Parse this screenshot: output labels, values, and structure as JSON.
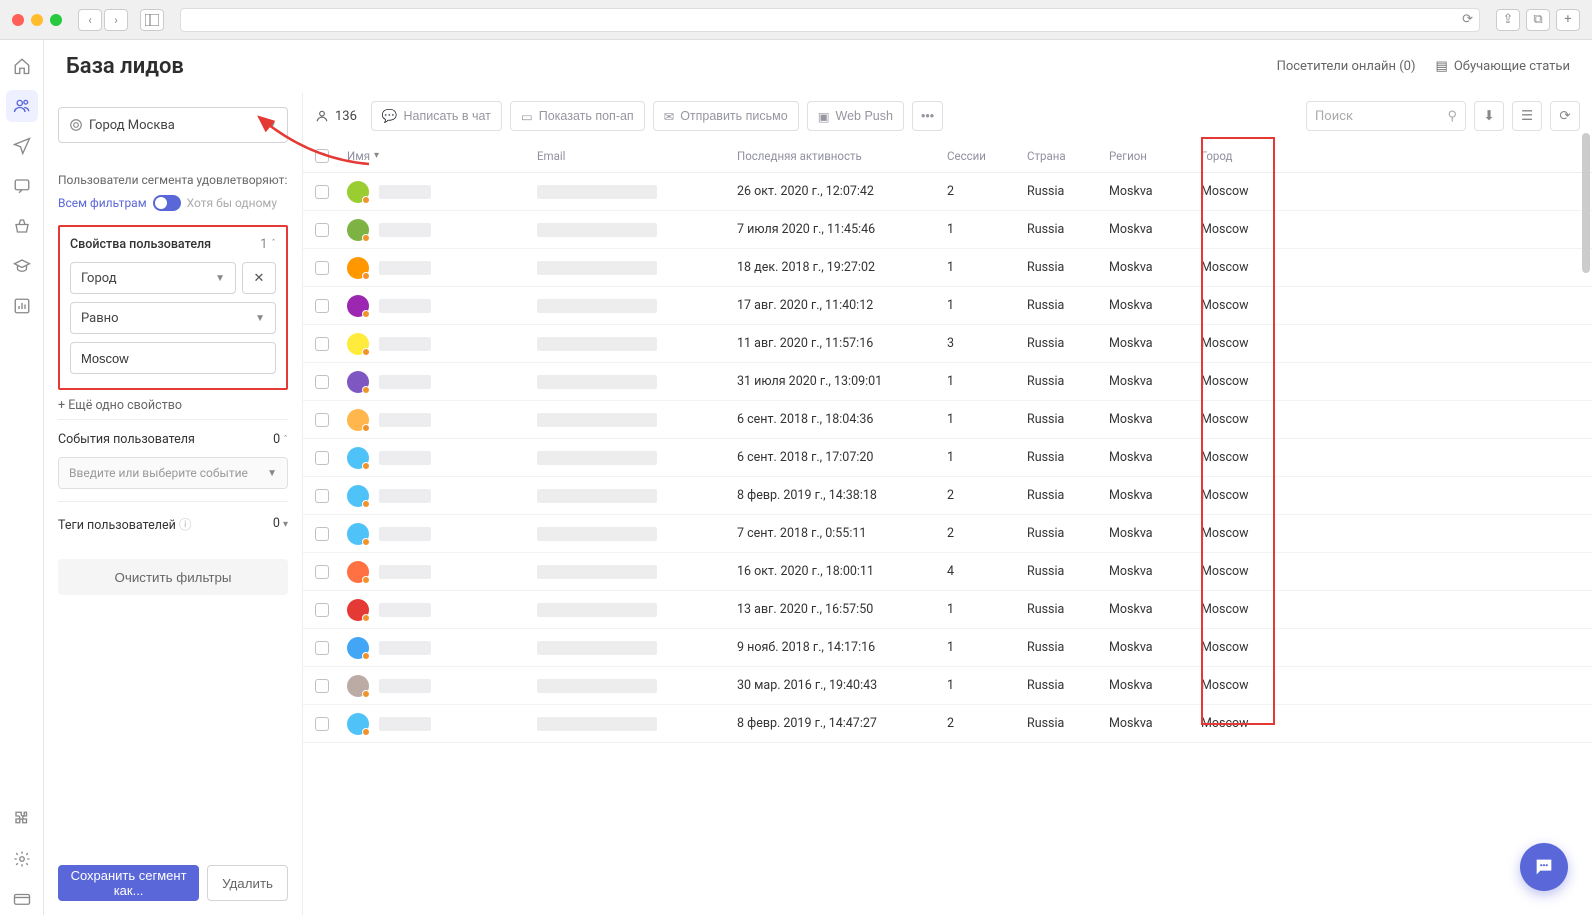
{
  "header": {
    "title": "База лидов",
    "visitors_online": "Посетители онлайн (0)",
    "tutorials": "Обучающие статьи"
  },
  "segment": {
    "label": "Город Москва"
  },
  "filter_note": "Пользователи сегмента удовлетворяют:",
  "filter_mode": {
    "all": "Всем фильтрам",
    "any": "Хотя бы одному"
  },
  "user_props": {
    "title": "Свойства пользователя",
    "count": "1",
    "property": "Город",
    "operator": "Равно",
    "value": "Moscow",
    "add_more": "+ Ещё одно свойство"
  },
  "events": {
    "title": "События пользователя",
    "count": "0",
    "placeholder": "Введите или выберите событие"
  },
  "tags": {
    "title": "Теги пользователей",
    "count": "0"
  },
  "clear_filters": "Очистить фильтры",
  "footer": {
    "save": "Сохранить сегмент как...",
    "delete": "Удалить"
  },
  "toolbar": {
    "count": "136",
    "chat": "Написать в чат",
    "popup": "Показать поп-ап",
    "email": "Отправить письмо",
    "push": "Web Push",
    "search_placeholder": "Поиск"
  },
  "columns": {
    "name": "Имя",
    "email": "Email",
    "activity": "Последняя активность",
    "sessions": "Сессии",
    "country": "Страна",
    "region": "Регион",
    "city": "Город"
  },
  "rows": [
    {
      "color": "#9acd32",
      "activity": "26 окт. 2020 г., 12:07:42",
      "sessions": "2",
      "country": "Russia",
      "region": "Moskva",
      "city": "Moscow"
    },
    {
      "color": "#7cb342",
      "activity": "7 июля 2020 г., 11:45:46",
      "sessions": "1",
      "country": "Russia",
      "region": "Moskva",
      "city": "Moscow"
    },
    {
      "color": "#ff9800",
      "activity": "18 дек. 2018 г., 19:27:02",
      "sessions": "1",
      "country": "Russia",
      "region": "Moskva",
      "city": "Moscow"
    },
    {
      "color": "#9c27b0",
      "activity": "17 авг. 2020 г., 11:40:12",
      "sessions": "1",
      "country": "Russia",
      "region": "Moskva",
      "city": "Moscow"
    },
    {
      "color": "#ffeb3b",
      "activity": "11 авг. 2020 г., 11:57:16",
      "sessions": "3",
      "country": "Russia",
      "region": "Moskva",
      "city": "Moscow"
    },
    {
      "color": "#7e57c2",
      "activity": "31 июля 2020 г., 13:09:01",
      "sessions": "1",
      "country": "Russia",
      "region": "Moskva",
      "city": "Moscow"
    },
    {
      "color": "#ffb74d",
      "activity": "6 сент. 2018 г., 18:04:36",
      "sessions": "1",
      "country": "Russia",
      "region": "Moskva",
      "city": "Moscow"
    },
    {
      "color": "#4fc3f7",
      "activity": "6 сент. 2018 г., 17:07:20",
      "sessions": "1",
      "country": "Russia",
      "region": "Moskva",
      "city": "Moscow"
    },
    {
      "color": "#4fc3f7",
      "activity": "8 февр. 2019 г., 14:38:18",
      "sessions": "2",
      "country": "Russia",
      "region": "Moskva",
      "city": "Moscow"
    },
    {
      "color": "#4fc3f7",
      "activity": "7 сент. 2018 г., 0:55:11",
      "sessions": "2",
      "country": "Russia",
      "region": "Moskva",
      "city": "Moscow"
    },
    {
      "color": "#ff7043",
      "activity": "16 окт. 2020 г., 18:00:11",
      "sessions": "4",
      "country": "Russia",
      "region": "Moskva",
      "city": "Moscow"
    },
    {
      "color": "#e53935",
      "activity": "13 авг. 2020 г., 16:57:50",
      "sessions": "1",
      "country": "Russia",
      "region": "Moskva",
      "city": "Moscow"
    },
    {
      "color": "#42a5f5",
      "activity": "9 нояб. 2018 г., 14:17:16",
      "sessions": "1",
      "country": "Russia",
      "region": "Moskva",
      "city": "Moscow"
    },
    {
      "color": "#bcaaa4",
      "activity": "30 мар. 2016 г., 19:40:43",
      "sessions": "1",
      "country": "Russia",
      "region": "Moskva",
      "city": "Moscow"
    },
    {
      "color": "#4fc3f7",
      "activity": "8 февр. 2019 г., 14:47:27",
      "sessions": "2",
      "country": "Russia",
      "region": "Moskva",
      "city": "Moscow"
    }
  ]
}
